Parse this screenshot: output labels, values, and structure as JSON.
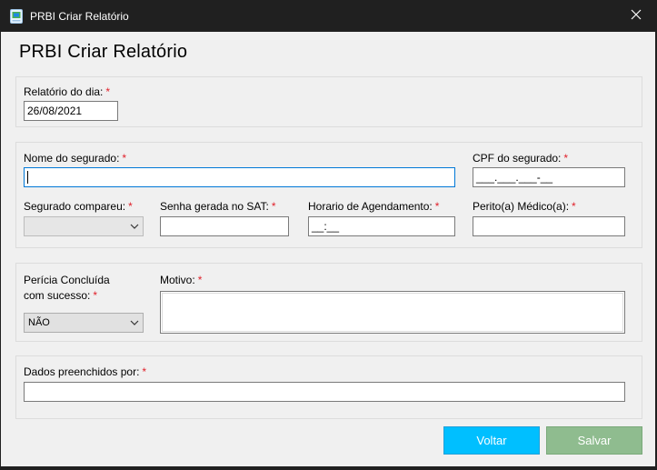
{
  "window": {
    "title": "PRBI Criar Relatório",
    "close_glyph": "✕",
    "app_icon": "report-app-icon"
  },
  "heading": "PRBI Criar Relatório",
  "required_marker": "*",
  "section_date": {
    "label": "Relatório do dia:",
    "value": "26/08/2021"
  },
  "section_insured": {
    "name_label": "Nome do segurado:",
    "name_value": "",
    "cpf_label": "CPF do segurado:",
    "cpf_mask": "___.___.___-__",
    "attended_label": "Segurado compareu:",
    "attended_value": "",
    "sat_label": "Senha gerada no SAT:",
    "sat_value": "",
    "schedule_label": "Horario de Agendamento:",
    "schedule_mask": "__:__",
    "doctor_label": "Perito(a) Médico(a):",
    "doctor_value": ""
  },
  "section_result": {
    "success_label_line1": "Perícia Concluída",
    "success_label_line2": "com sucesso:",
    "success_value": "NÃO",
    "reason_label": "Motivo:",
    "reason_value": ""
  },
  "section_filled_by": {
    "label": "Dados preenchidos por:",
    "value": ""
  },
  "buttons": {
    "back": "Voltar",
    "save": "Salvar"
  },
  "colors": {
    "back_button": "#00bfff",
    "save_button": "#8fbc8f",
    "required": "#e0202a",
    "focus_border": "#0078d7"
  }
}
